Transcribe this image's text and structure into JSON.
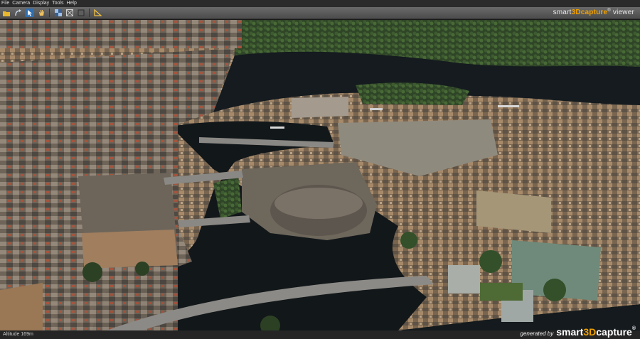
{
  "menu": {
    "items": [
      "File",
      "Camera",
      "Display",
      "Tools",
      "Help"
    ]
  },
  "toolbar": {
    "buttons": [
      {
        "icon": "folder-open-icon"
      },
      {
        "icon": "navigate-icon"
      },
      {
        "icon": "select-icon"
      },
      {
        "icon": "hand-icon"
      },
      {
        "icon": "checker-icon"
      },
      {
        "icon": "grid-icon"
      },
      {
        "icon": "layers-icon"
      },
      {
        "icon": "measure-icon"
      }
    ]
  },
  "brand": {
    "top_pre": "smart",
    "top_accent": "3Dcapture",
    "top_reg": "®",
    "top_post": " viewer",
    "bottom_generated": "generated by",
    "bottom_pre": "smart",
    "bottom_accent": "3D",
    "bottom_post": "capture",
    "bottom_reg": "®"
  },
  "status": {
    "left_text": "Altitude 169m"
  },
  "colors": {
    "accent": "#f0a000",
    "water": "#14191c",
    "rooftops": "#8a6e58",
    "greenery": "#3f5a2f"
  }
}
